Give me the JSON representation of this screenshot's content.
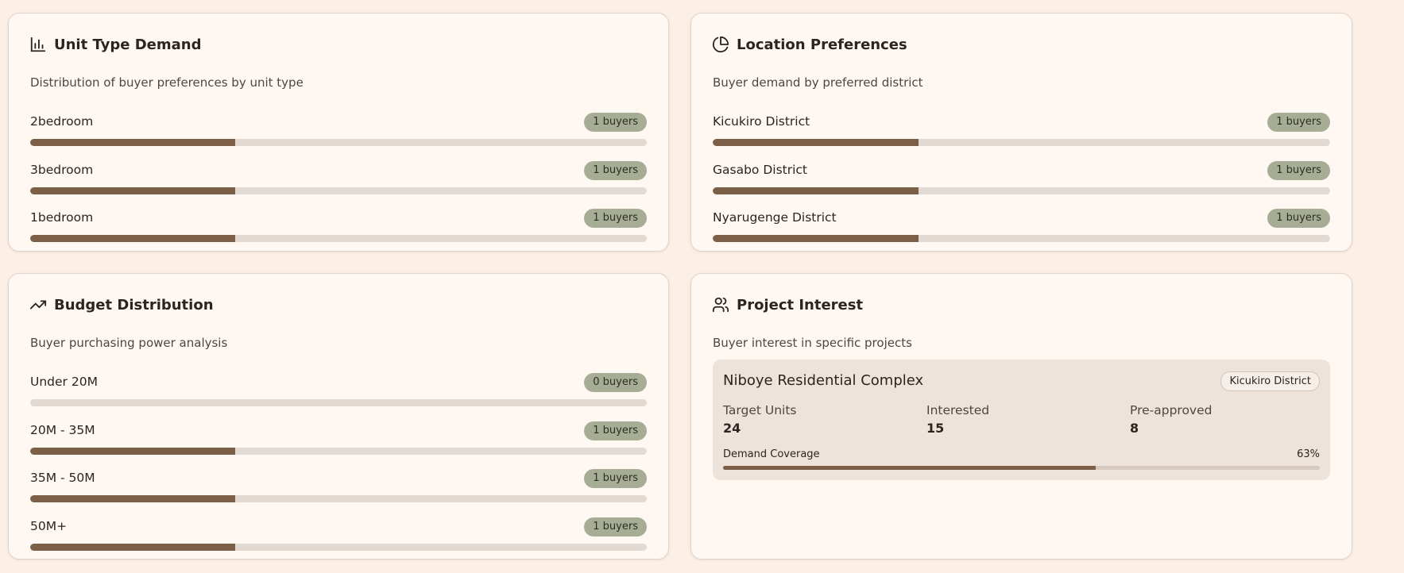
{
  "colors": {
    "page_bg": "#fcefe6",
    "card_bg": "#fff7f2",
    "bar_fill": "#7b5f46",
    "bar_track": "#e2d9d2",
    "badge_bg": "#a7ad94",
    "project_box_bg": "#ede3da"
  },
  "unit_type": {
    "icon": "bar-chart-icon",
    "title": "Unit Type Demand",
    "subtitle": "Distribution of buyer preferences by unit type",
    "rows": [
      {
        "label": "2bedroom",
        "badge": "1 buyers",
        "fill": 0.333
      },
      {
        "label": "3bedroom",
        "badge": "1 buyers",
        "fill": 0.333
      },
      {
        "label": "1bedroom",
        "badge": "1 buyers",
        "fill": 0.333
      }
    ]
  },
  "location": {
    "icon": "pie-chart-icon",
    "title": "Location Preferences",
    "subtitle": "Buyer demand by preferred district",
    "rows": [
      {
        "label": "Kicukiro District",
        "badge": "1 buyers",
        "fill": 0.333
      },
      {
        "label": "Gasabo District",
        "badge": "1 buyers",
        "fill": 0.333
      },
      {
        "label": "Nyarugenge District",
        "badge": "1 buyers",
        "fill": 0.333
      }
    ]
  },
  "budget": {
    "icon": "trending-up-icon",
    "title": "Budget Distribution",
    "subtitle": "Buyer purchasing power analysis",
    "rows": [
      {
        "label": "Under 20M",
        "badge": "0 buyers",
        "fill": 0
      },
      {
        "label": "20M - 35M",
        "badge": "1 buyers",
        "fill": 0.333
      },
      {
        "label": "35M - 50M",
        "badge": "1 buyers",
        "fill": 0.333
      },
      {
        "label": "50M+",
        "badge": "1 buyers",
        "fill": 0.333
      }
    ]
  },
  "project": {
    "icon": "users-icon",
    "title": "Project Interest",
    "subtitle": "Buyer interest in specific projects",
    "item": {
      "name": "Niboye Residential Complex",
      "district": "Kicukiro District",
      "target_label": "Target Units",
      "target_value": "24",
      "interested_label": "Interested",
      "interested_value": "15",
      "preapproved_label": "Pre-approved",
      "preapproved_value": "8",
      "coverage_label": "Demand Coverage",
      "coverage_value": "63%",
      "coverage_fill": 0.625
    }
  }
}
